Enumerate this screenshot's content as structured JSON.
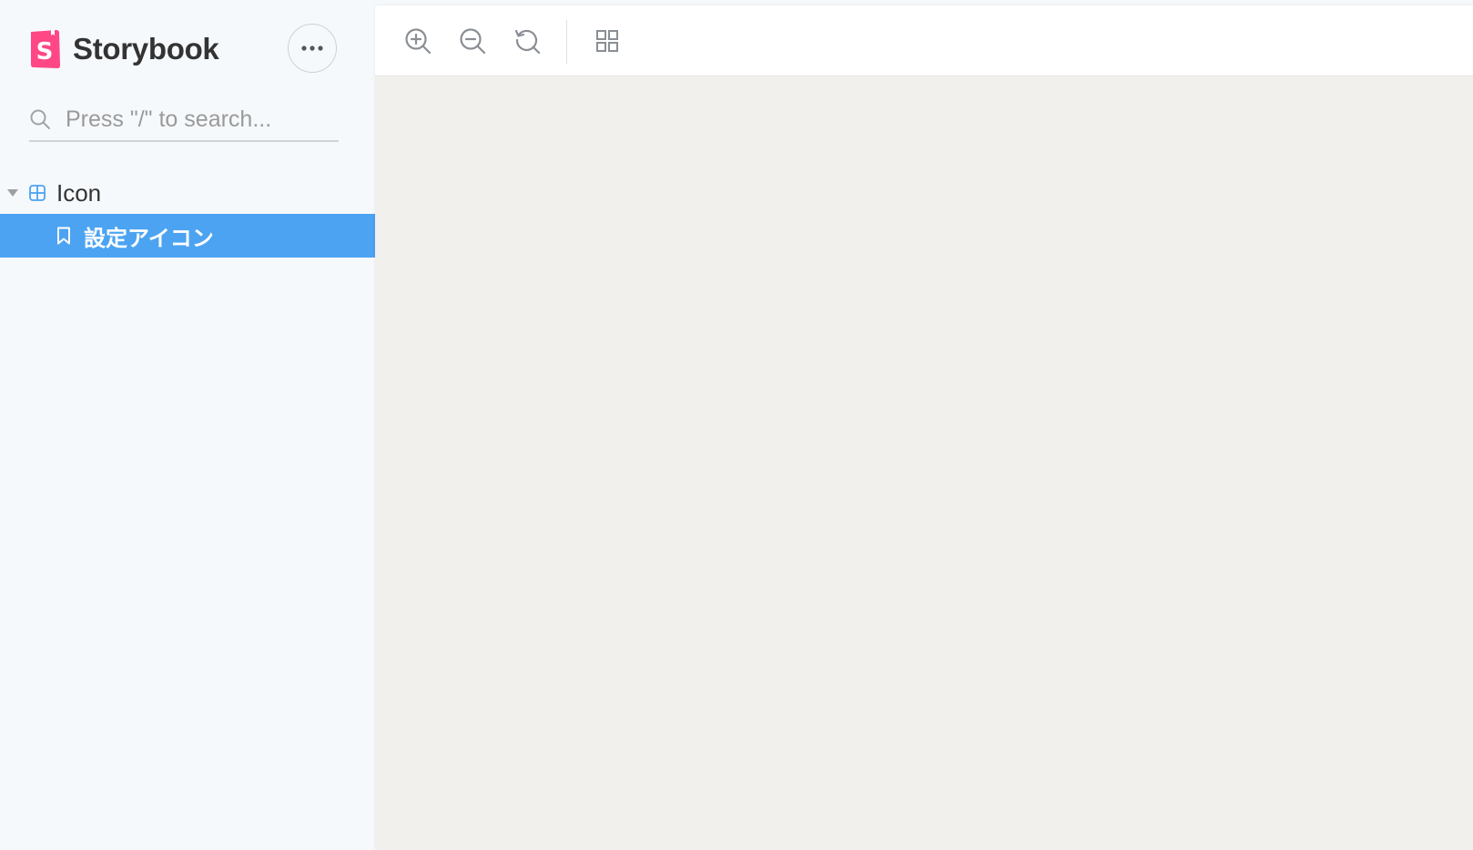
{
  "brand": {
    "name": "Storybook",
    "logo_letter": "S",
    "logo_color": "#ff4785"
  },
  "menu_button": {
    "icon": "ellipsis-icon"
  },
  "search": {
    "placeholder": "Press \"/\" to search...",
    "value": "",
    "icon": "search-icon"
  },
  "sidebar": {
    "groups": [
      {
        "label": "Icon",
        "icon": "component-icon",
        "expanded": true,
        "stories": [
          {
            "label": "設定アイコン",
            "icon": "bookmark-icon",
            "selected": true
          }
        ]
      }
    ]
  },
  "toolbar": {
    "tools": [
      {
        "name": "zoom-in",
        "icon": "zoom-in-icon"
      },
      {
        "name": "zoom-out",
        "icon": "zoom-out-icon"
      },
      {
        "name": "zoom-reset",
        "icon": "zoom-reset-icon"
      },
      {
        "name": "grid",
        "icon": "grid-icon"
      }
    ]
  },
  "colors": {
    "accent": "#4ca3f1",
    "brand": "#ff4785",
    "sidebar_bg": "#f6f9fc",
    "canvas_bg": "#f1f0ed"
  }
}
